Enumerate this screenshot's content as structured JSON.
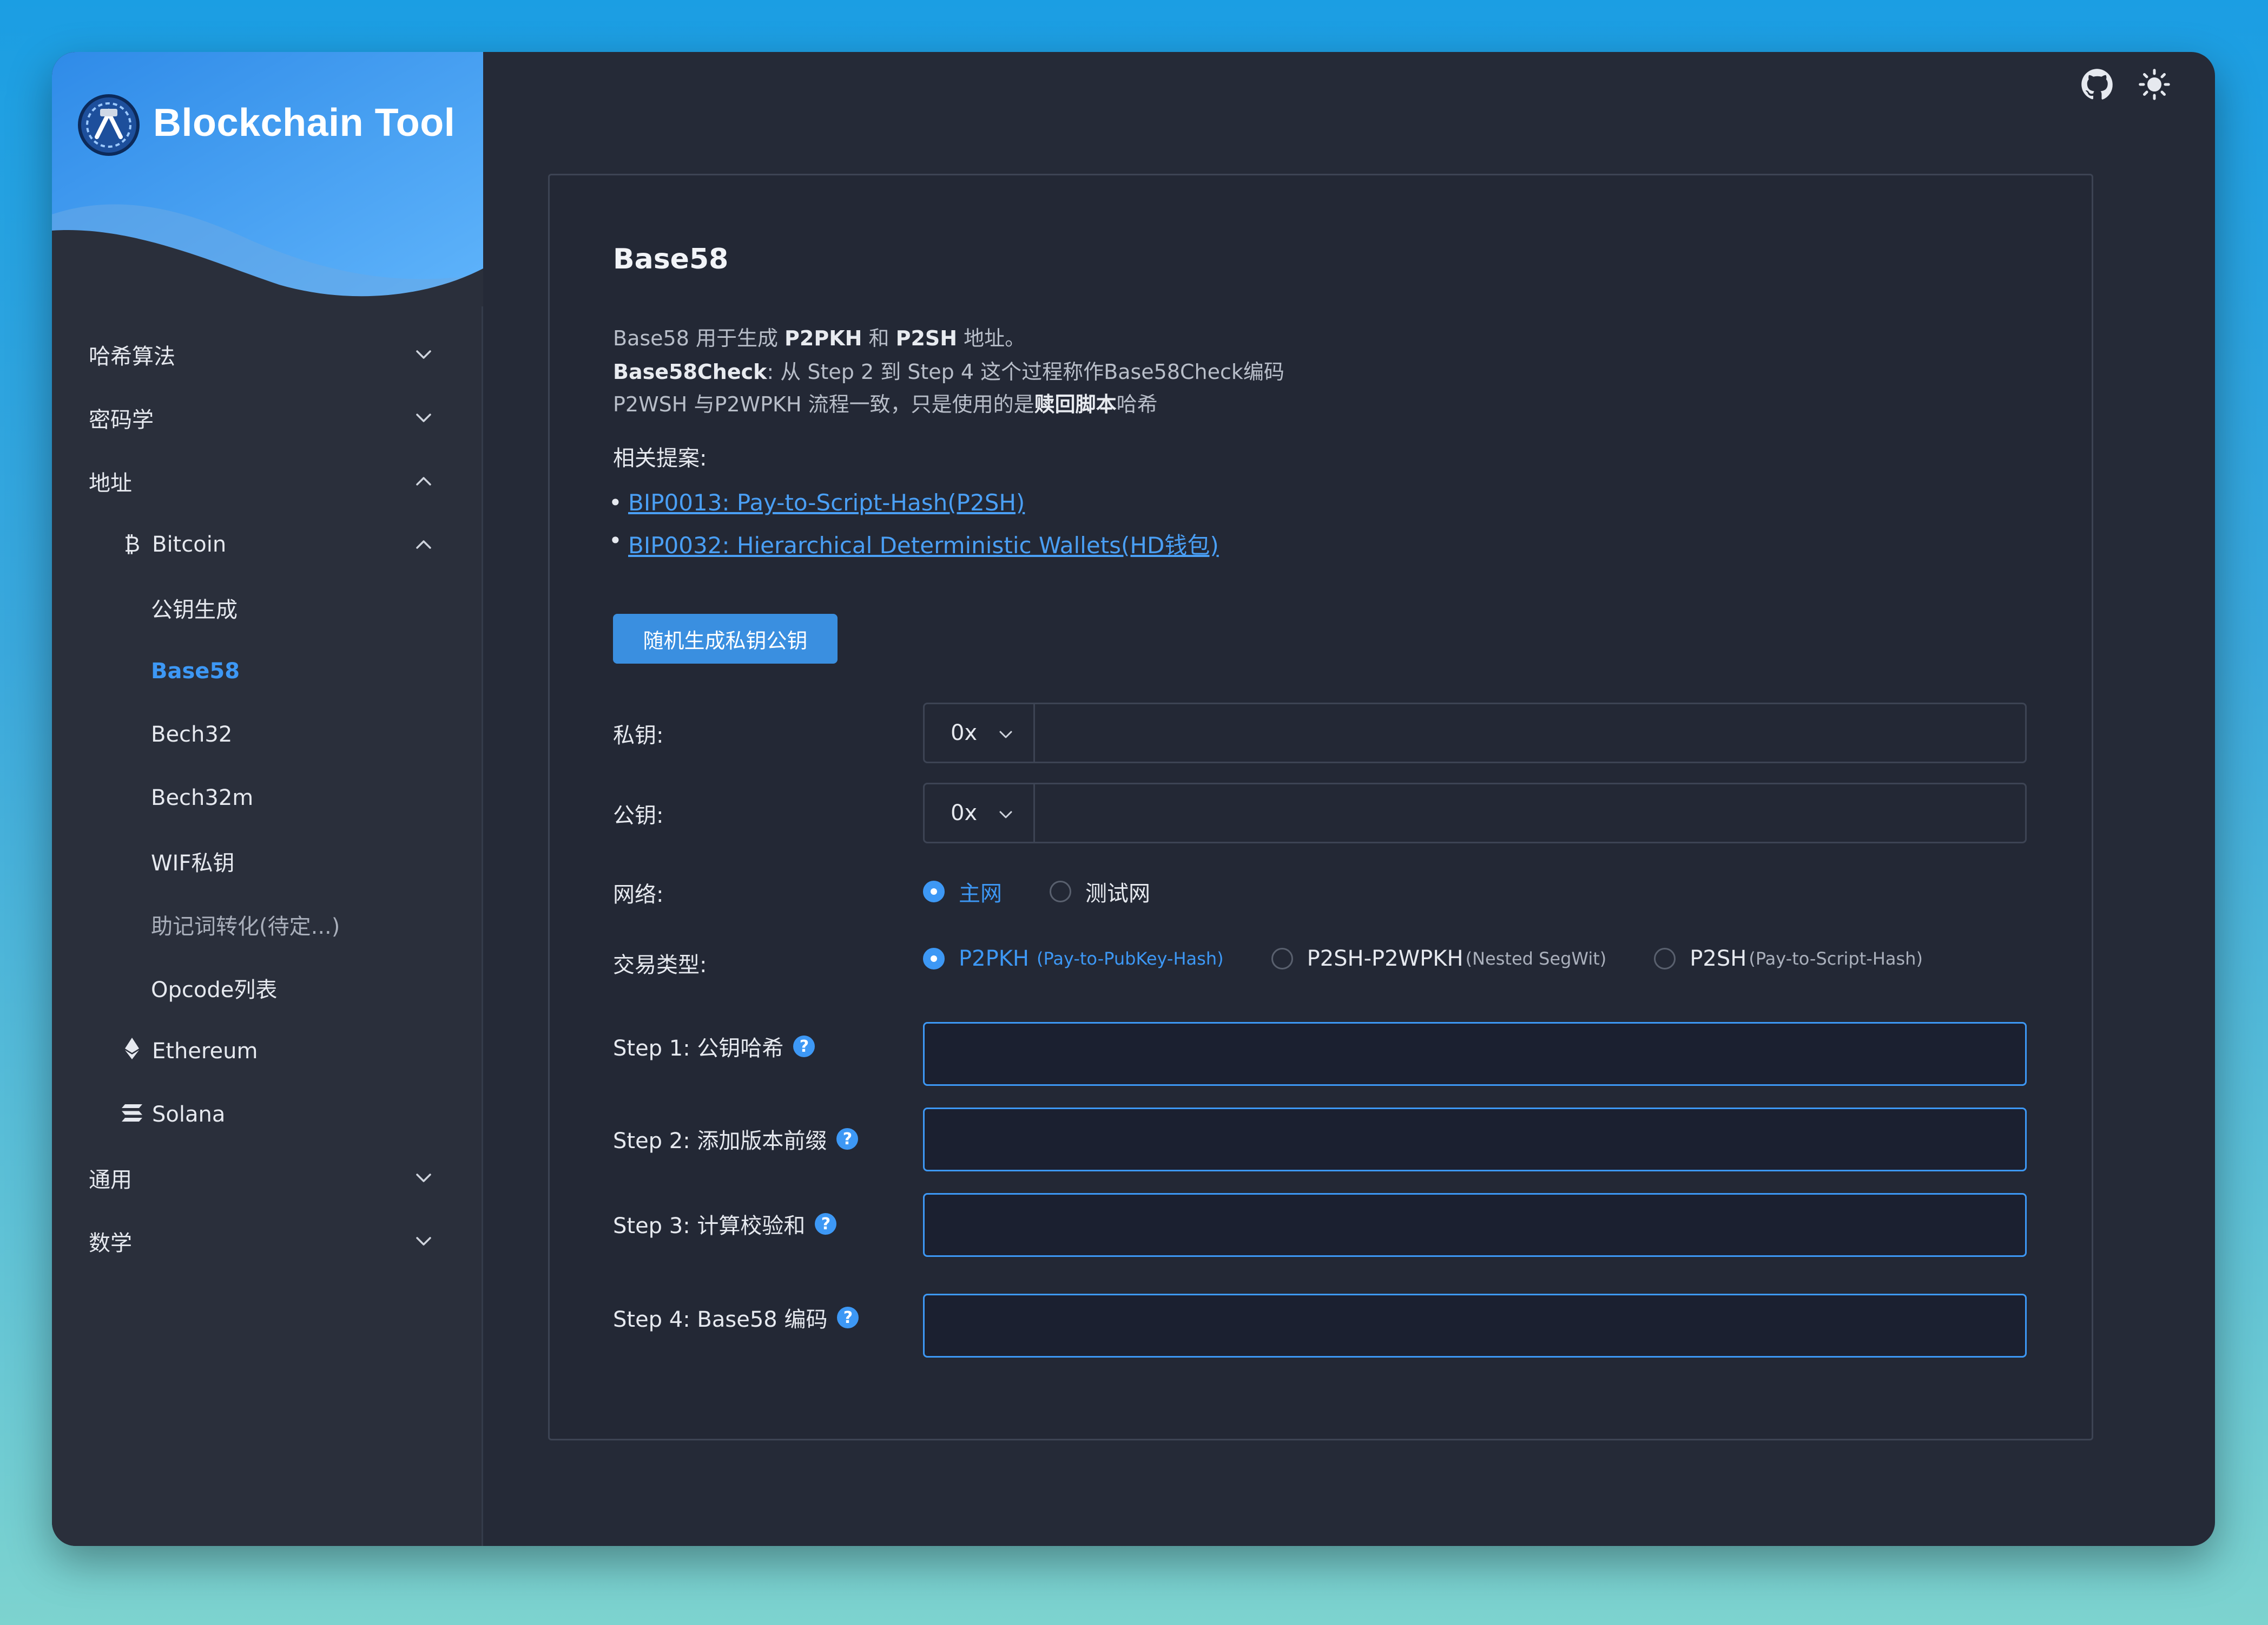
{
  "app": {
    "title": "Blockchain Tool"
  },
  "sidebar": {
    "items": [
      {
        "label": "哈希算法",
        "state": "collapsed"
      },
      {
        "label": "密码学",
        "state": "collapsed"
      },
      {
        "label": "地址",
        "state": "expanded"
      },
      {
        "label": "Bitcoin",
        "icon": "bitcoin-icon",
        "state": "expanded"
      },
      {
        "label": "公钥生成"
      },
      {
        "label": "Base58",
        "active": true
      },
      {
        "label": "Bech32"
      },
      {
        "label": "Bech32m"
      },
      {
        "label": "WIF私钥"
      },
      {
        "label": "助记词转化(待定...)"
      },
      {
        "label": "Opcode列表"
      },
      {
        "label": "Ethereum",
        "icon": "ethereum-icon"
      },
      {
        "label": "Solana",
        "icon": "solana-icon"
      },
      {
        "label": "通用",
        "state": "collapsed"
      },
      {
        "label": "数学",
        "state": "collapsed"
      }
    ]
  },
  "header": {
    "icons": [
      "github-icon",
      "sun-icon"
    ]
  },
  "main": {
    "title": "Base58",
    "desc1_a": "Base58 用于生成 ",
    "desc1_b": "P2PKH",
    "desc1_c": " 和 ",
    "desc1_d": "P2SH",
    "desc1_e": " 地址。",
    "desc2_a": "Base58Check",
    "desc2_b": ": 从 Step 2 到 Step 4 这个过程称作Base58Check编码",
    "desc3_a": "P2WSH 与P2WPKH 流程一致，只是使用的是",
    "desc3_b": "赎回脚本",
    "desc3_c": "哈希",
    "refs_title": "相关提案:",
    "refs": [
      "BIP0013: Pay-to-Script-Hash(P2SH)",
      "BIP0032: Hierarchical Deterministic Wallets(HD钱包)"
    ],
    "generate_button": "随机生成私钥公钥",
    "private_key": {
      "label": "私钥:",
      "prefix": "0x",
      "value": ""
    },
    "public_key": {
      "label": "公钥:",
      "prefix": "0x",
      "value": ""
    },
    "network": {
      "label": "网络:",
      "options": [
        "主网",
        "测试网"
      ],
      "selected": "主网"
    },
    "tx_type": {
      "label": "交易类型:",
      "options": [
        {
          "name": "P2PKH",
          "sub": "(Pay-to-PubKey-Hash)"
        },
        {
          "name": "P2SH-P2WPKH",
          "sub": "(Nested SegWit)"
        },
        {
          "name": "P2SH",
          "sub": "(Pay-to-Script-Hash)"
        }
      ],
      "selected": "P2PKH"
    },
    "steps": [
      {
        "label": "Step 1: 公钥哈希",
        "value": ""
      },
      {
        "label": "Step 2: 添加版本前缀",
        "value": ""
      },
      {
        "label": "Step 3: 计算校验和",
        "value": ""
      },
      {
        "label": "Step 4: Base58 编码",
        "value": ""
      }
    ],
    "help_glyph": "?"
  },
  "colors": {
    "accent": "#3d98f5",
    "background": "#252a37",
    "sidebar": "#2a2f3b"
  }
}
